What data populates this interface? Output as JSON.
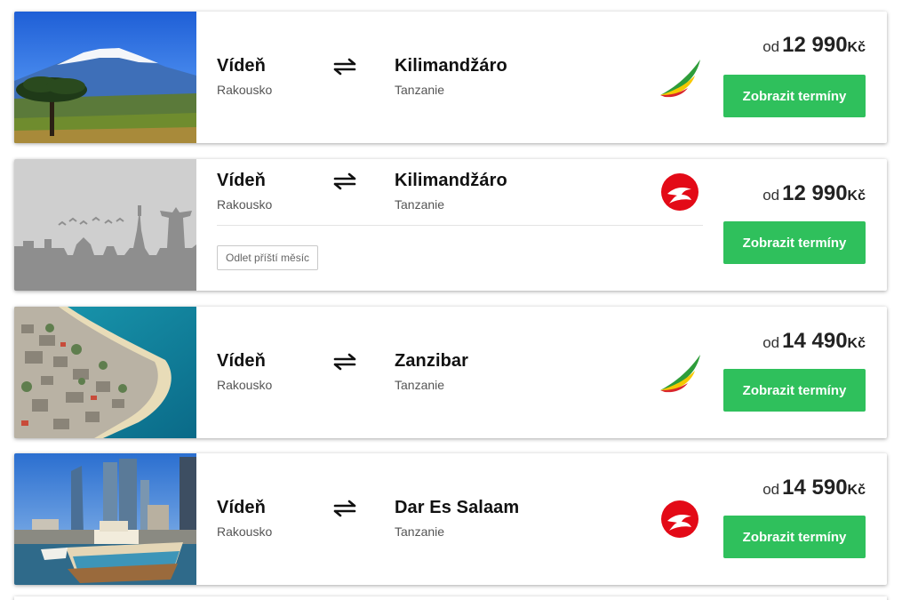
{
  "results": [
    {
      "photo": "mount-kilimanjaro-photo",
      "from": {
        "city": "Vídeň",
        "country": "Rakousko"
      },
      "to": {
        "city": "Kilimandžáro",
        "country": "Tanzanie"
      },
      "airline_logo": "ethiopian-airlines-logo",
      "price_prefix": "od",
      "price_amount": "12 990",
      "price_currency": "Kč",
      "button_label": "Zobrazit termíny"
    },
    {
      "photo": "city-skyline-placeholder",
      "from": {
        "city": "Vídeň",
        "country": "Rakousko"
      },
      "to": {
        "city": "Kilimandžáro",
        "country": "Tanzanie"
      },
      "tag": "Odlet příští měsíc",
      "airline_logo": "turkish-airlines-logo",
      "price_prefix": "od",
      "price_amount": "12 990",
      "price_currency": "Kč",
      "button_label": "Zobrazit termíny"
    },
    {
      "photo": "zanzibar-coast-photo",
      "from": {
        "city": "Vídeň",
        "country": "Rakousko"
      },
      "to": {
        "city": "Zanzibar",
        "country": "Tanzanie"
      },
      "airline_logo": "ethiopian-airlines-logo",
      "price_prefix": "od",
      "price_amount": "14 490",
      "price_currency": "Kč",
      "button_label": "Zobrazit termíny"
    },
    {
      "photo": "dar-es-salaam-harbor-photo",
      "from": {
        "city": "Vídeň",
        "country": "Rakousko"
      },
      "to": {
        "city": "Dar Es Salaam",
        "country": "Tanzanie"
      },
      "airline_logo": "turkish-airlines-logo",
      "price_prefix": "od",
      "price_amount": "14 590",
      "price_currency": "Kč",
      "button_label": "Zobrazit termíny"
    }
  ],
  "colors": {
    "button": "#2fc05c",
    "ethiopian_green": "#2e9d3a",
    "ethiopian_yellow": "#f6c800",
    "ethiopian_red": "#d9262c",
    "turkish_red": "#e30a17"
  }
}
